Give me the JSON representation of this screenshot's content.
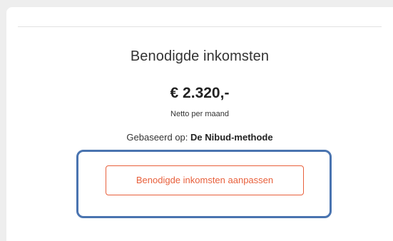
{
  "card": {
    "title": "Benodigde inkomsten",
    "amount": "€ 2.320,-",
    "period": "Netto per maand",
    "based_on_label": "Gebaseerd op:",
    "based_on_value": "De Nibud-methode",
    "adjust_button_label": "Benodigde inkomsten aanpassen"
  },
  "colors": {
    "accent": "#e8603c",
    "highlight": "#4a74b0"
  }
}
